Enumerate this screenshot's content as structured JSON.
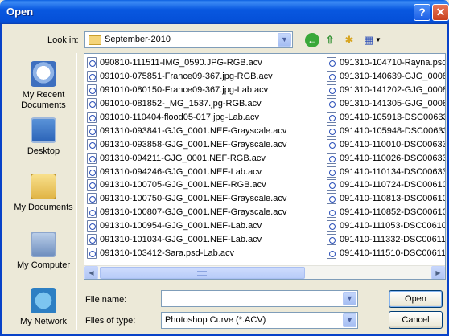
{
  "window": {
    "title": "Open",
    "help_glyph": "?",
    "close_glyph": "✕"
  },
  "toolbar": {
    "look_in_label": "Look in:",
    "look_in_value": "September-2010"
  },
  "places": [
    {
      "label": "My Recent Documents",
      "icon": "recent-documents-icon"
    },
    {
      "label": "Desktop",
      "icon": "desktop-icon"
    },
    {
      "label": "My Documents",
      "icon": "my-documents-icon"
    },
    {
      "label": "My Computer",
      "icon": "my-computer-icon"
    },
    {
      "label": "My Network",
      "icon": "my-network-icon"
    }
  ],
  "files_col1": [
    "090810-111511-IMG_0590.JPG-RGB.acv",
    "091010-075851-France09-367.jpg-RGB.acv",
    "091010-080150-France09-367.jpg-Lab.acv",
    "091010-081852-_MG_1537.jpg-RGB.acv",
    "091010-110404-flood05-017.jpg-Lab.acv",
    "091310-093841-GJG_0001.NEF-Grayscale.acv",
    "091310-093858-GJG_0001.NEF-Grayscale.acv",
    "091310-094211-GJG_0001.NEF-RGB.acv",
    "091310-094246-GJG_0001.NEF-Lab.acv",
    "091310-100705-GJG_0001.NEF-RGB.acv",
    "091310-100750-GJG_0001.NEF-Grayscale.acv",
    "091310-100807-GJG_0001.NEF-Grayscale.acv",
    "091310-100954-GJG_0001.NEF-Lab.acv",
    "091310-101034-GJG_0001.NEF-Lab.acv",
    "091310-103412-Sara.psd-Lab.acv"
  ],
  "files_col2": [
    "091310-104710-Rayna.psd",
    "091310-140639-GJG_0008",
    "091310-141202-GJG_0008",
    "091310-141305-GJG_0008",
    "091410-105913-DSC00633",
    "091410-105948-DSC00633",
    "091410-110010-DSC00633",
    "091410-110026-DSC00633",
    "091410-110134-DSC00633",
    "091410-110724-DSC00610",
    "091410-110813-DSC00610",
    "091410-110852-DSC00610",
    "091410-111053-DSC00610",
    "091410-111332-DSC00611",
    "091410-111510-DSC00611"
  ],
  "bottom": {
    "file_name_label": "File name:",
    "file_name_value": "",
    "file_type_label": "Files of type:",
    "file_type_value": "Photoshop Curve (*.ACV)",
    "open_label": "Open",
    "cancel_label": "Cancel"
  }
}
